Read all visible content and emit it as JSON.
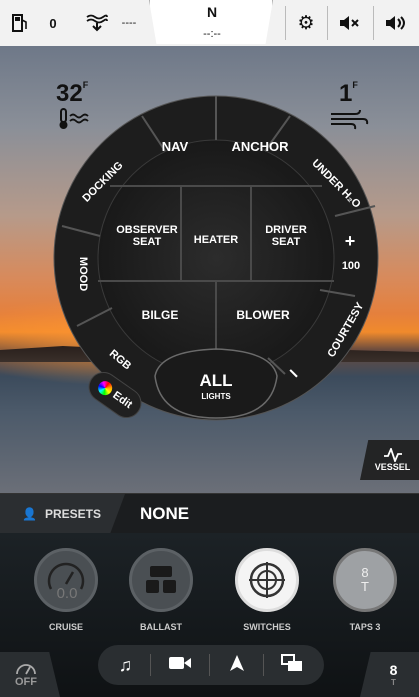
{
  "topbar": {
    "fuel_value": "0",
    "depth_value": "----",
    "compass_heading": "N",
    "compass_sub": "--:--"
  },
  "weather": {
    "water_temp": "32",
    "water_unit": "F",
    "wind_speed": "1",
    "wind_unit": "F"
  },
  "dial": {
    "nav": "NAV",
    "anchor": "ANCHOR",
    "under_h2o": "UNDER H₂O",
    "docking": "DOCKING",
    "observer_seat_1": "OBSERVER",
    "observer_seat_2": "SEAT",
    "heater": "HEATER",
    "driver_seat_1": "DRIVER",
    "driver_seat_2": "SEAT",
    "mood": "MOOD",
    "bilge": "BILGE",
    "blower": "BLOWER",
    "rgb": "RGB",
    "courtesy": "COURTESY",
    "brightness_plus": "+",
    "brightness_value": "100",
    "brightness_minus": "I",
    "all_label": "ALL",
    "all_sub": "LIGHTS",
    "edit_label": "Edit"
  },
  "vessel_button": "VESSEL",
  "presets": {
    "label": "PRESETS",
    "value": "NONE"
  },
  "dock": {
    "cruise_label": "CRUISE",
    "cruise_value": "0.0",
    "ballast_label": "BALLAST",
    "switches_label": "SWITCHES",
    "taps_label": "TAPS 3",
    "taps_value": "8",
    "taps_sub": "T"
  },
  "corner_left": {
    "label": "OFF"
  },
  "corner_right": {
    "value": "8",
    "sub": "T"
  },
  "colors": {
    "panel": "#1b1d1f",
    "dial_segment": "#232323",
    "accent_white": "#ffffff"
  }
}
